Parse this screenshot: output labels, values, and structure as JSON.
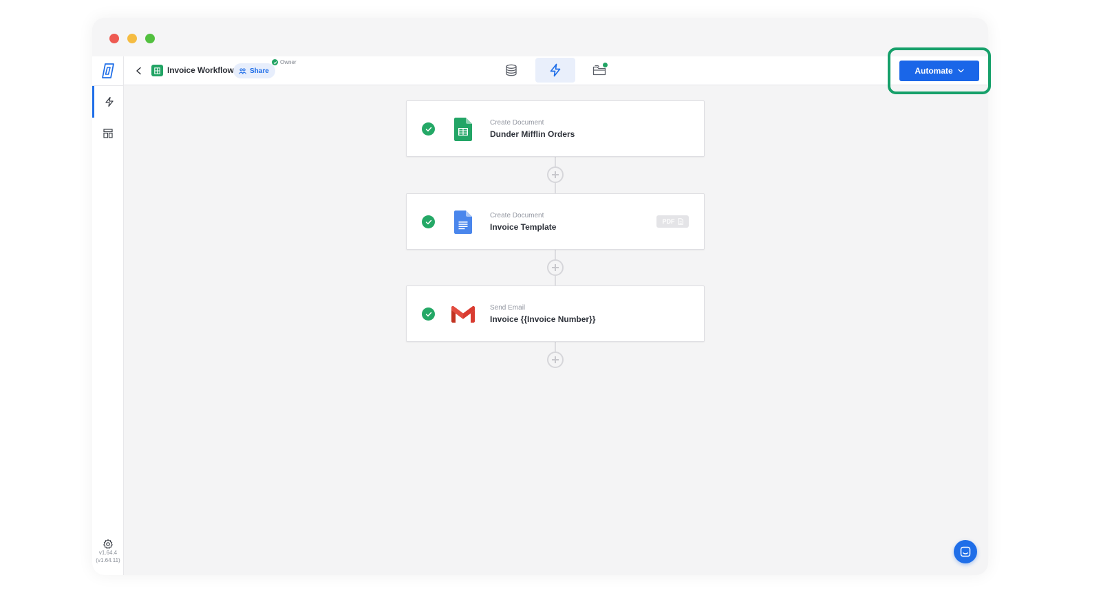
{
  "workflow": {
    "title": "Invoice Workflow",
    "share_label": "Share",
    "owner_label": "Owner"
  },
  "toolbar": {
    "automate_label": "Automate"
  },
  "view_tabs": [
    {
      "icon": "database-icon",
      "active": false
    },
    {
      "icon": "lightning-icon",
      "active": true
    },
    {
      "icon": "folder-icon",
      "active": false,
      "indicator": "#21a464"
    }
  ],
  "sidebar": {
    "items": [
      {
        "icon": "lightning-icon",
        "active": true
      },
      {
        "icon": "layout-icon",
        "active": false
      }
    ],
    "settings_icon": "gear-icon",
    "version": "v1.64.4",
    "version_sub": "(v1.64.11)"
  },
  "steps": [
    {
      "kind": "Create Document",
      "name": "Dunder Mifflin Orders",
      "icon": "google-sheets-icon",
      "status": "complete"
    },
    {
      "kind": "Create Document",
      "name": "Invoice Template",
      "icon": "google-docs-icon",
      "status": "complete",
      "badge": "PDF"
    },
    {
      "kind": "Send Email",
      "name": "Invoice {{Invoice Number}}",
      "icon": "gmail-icon",
      "status": "complete"
    }
  ],
  "colors": {
    "accent": "#1a66e8",
    "success": "#24a866",
    "highlight": "#16a06a"
  }
}
